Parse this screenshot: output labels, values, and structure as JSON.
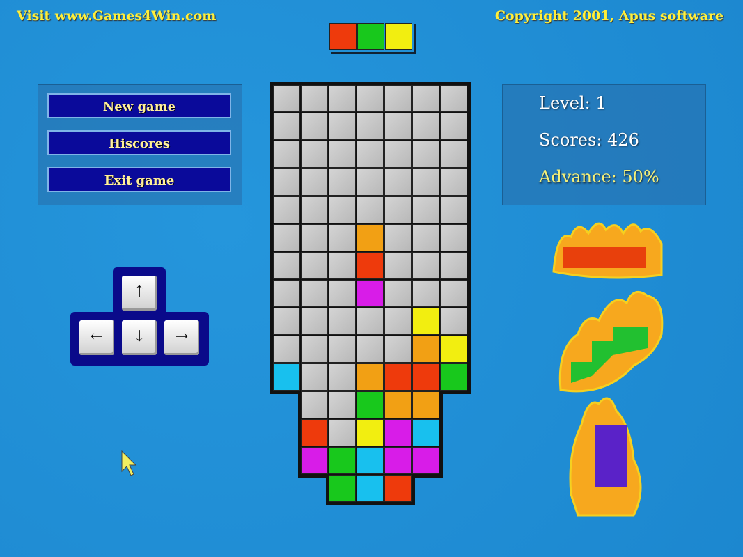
{
  "header": {
    "left": "Visit www.Games4Win.com",
    "right": "Copyright 2001, Apus software"
  },
  "menu": {
    "new_game": "New game",
    "hiscores": "Hiscores",
    "exit_game": "Exit game"
  },
  "stats": {
    "level_label": "Level: 1",
    "scores_label": "Scores: 426",
    "advance_label": "Advance: 50%",
    "level": 1,
    "scores": 426,
    "advance_percent": 50
  },
  "keys": {
    "up": "↑",
    "left": "←",
    "down": "↓",
    "right": "→"
  },
  "colors": {
    "R": "#ee3a0c",
    "O": "#f2a014",
    "Y": "#f2ee10",
    "G": "#18c81c",
    "C": "#18c0ee",
    "M": "#d81ce8",
    "empty": "#c4c4c4"
  },
  "next_piece": [
    "R",
    "G",
    "Y"
  ],
  "board": [
    "_______",
    "_______",
    "_______",
    "_______",
    "_______",
    "___O___",
    "___R___",
    "___M___",
    "_____Y_",
    "_____OY",
    "C__ORRG",
    " __GOO ",
    " R_YMC ",
    " MGCMM ",
    "  GCR  "
  ]
}
